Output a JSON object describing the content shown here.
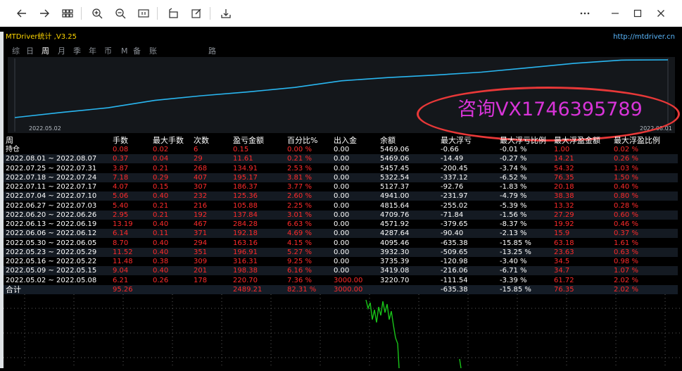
{
  "toolbar": {
    "icons": [
      "back-arrow-icon",
      "forward-arrow-icon",
      "grid-icon",
      "zoom-in-icon",
      "zoom-out-icon",
      "fit-icon",
      "rotate-icon",
      "edit-icon",
      "save-icon",
      "more-icon",
      "minimize-icon",
      "maximize-icon",
      "close-icon"
    ]
  },
  "panel": {
    "title": "MTDriver统计 ,V3.25",
    "url": "http://mtdriver.cn",
    "tabs": [
      "综",
      "日",
      "周",
      "月",
      "季",
      "年",
      "币",
      "M",
      "备",
      "账户",
      "路径"
    ],
    "active_tab": "周"
  },
  "chart": {
    "start_date": "2022.05.02",
    "end_date": "2022.08.01",
    "line_color": "#29b6f0"
  },
  "watermark": {
    "text": "咨询VX1746395789"
  },
  "table": {
    "headers": [
      "周",
      "手数",
      "最大手数",
      "次数",
      "盈亏金额",
      "百分比%",
      "出入金",
      "余额",
      "最大浮亏",
      "最大浮亏比例",
      "最大浮盈金额",
      "最大浮盈比例"
    ],
    "rows": [
      [
        "持仓",
        "0.08",
        "0.02",
        "6",
        "0.15",
        "0.00 %",
        "0.00",
        "5469.06",
        "-0.66",
        "-0.01 %",
        "1.00",
        "0.02 %"
      ],
      [
        "2022.08.01 ~ 2022.08.07",
        "0.37",
        "0.04",
        "29",
        "11.61",
        "0.21 %",
        "0.00",
        "5469.06",
        "-14.49",
        "-0.27 %",
        "14.21",
        "0.26 %"
      ],
      [
        "2022.07.25 ~ 2022.07.31",
        "3.87",
        "0.21",
        "268",
        "134.91",
        "2.53 %",
        "0.00",
        "5457.45",
        "-200.45",
        "-3.74 %",
        "54.32",
        "1.03 %"
      ],
      [
        "2022.07.18 ~ 2022.07.24",
        "7.18",
        "0.29",
        "407",
        "195.17",
        "3.81 %",
        "0.00",
        "5322.54",
        "-337.12",
        "-6.52 %",
        "76.35",
        "1.50 %"
      ],
      [
        "2022.07.11 ~ 2022.07.17",
        "4.07",
        "0.15",
        "307",
        "186.37",
        "3.77 %",
        "0.00",
        "5127.37",
        "-92.76",
        "-1.83 %",
        "20.18",
        "0.40 %"
      ],
      [
        "2022.07.04 ~ 2022.07.10",
        "5.06",
        "0.40",
        "232",
        "125.36",
        "2.60 %",
        "0.00",
        "4941.00",
        "-231.97",
        "-4.79 %",
        "38.38",
        "0.80 %"
      ],
      [
        "2022.06.27 ~ 2022.07.03",
        "5.40",
        "0.21",
        "216",
        "105.88",
        "2.25 %",
        "0.00",
        "4815.64",
        "-255.02",
        "-5.39 %",
        "13.32",
        "0.28 %"
      ],
      [
        "2022.06.20 ~ 2022.06.26",
        "2.95",
        "0.21",
        "192",
        "137.84",
        "3.01 %",
        "0.00",
        "4709.76",
        "-71.84",
        "-1.56 %",
        "27.29",
        "0.60 %"
      ],
      [
        "2022.06.13 ~ 2022.06.19",
        "13.19",
        "0.40",
        "467",
        "284.28",
        "6.63 %",
        "0.00",
        "4571.92",
        "-379.65",
        "-8.37 %",
        "19.92",
        "0.46 %"
      ],
      [
        "2022.06.06 ~ 2022.06.12",
        "6.14",
        "0.11",
        "371",
        "192.18",
        "4.69 %",
        "0.00",
        "4287.64",
        "-90.40",
        "-2.13 %",
        "15.9",
        "0.37 %"
      ],
      [
        "2022.05.30 ~ 2022.06.05",
        "8.70",
        "0.40",
        "294",
        "163.16",
        "4.15 %",
        "0.00",
        "4095.46",
        "-635.38",
        "-15.85 %",
        "63.18",
        "1.61 %"
      ],
      [
        "2022.05.23 ~ 2022.05.29",
        "11.52",
        "0.40",
        "351",
        "196.91",
        "5.27 %",
        "0.00",
        "3932.30",
        "-509.65",
        "-13.25 %",
        "23.63",
        "0.63 %"
      ],
      [
        "2022.05.16 ~ 2022.05.22",
        "11.48",
        "0.38",
        "309",
        "316.31",
        "9.25 %",
        "0.00",
        "3735.39",
        "-120.98",
        "-3.40 %",
        "34.5",
        "0.98 %"
      ],
      [
        "2022.05.09 ~ 2022.05.15",
        "9.04",
        "0.40",
        "201",
        "198.38",
        "6.16 %",
        "0.00",
        "3419.08",
        "-216.06",
        "-6.71 %",
        "34.7",
        "1.07 %"
      ],
      [
        "2022.05.02 ~ 2022.05.08",
        "6.21",
        "0.26",
        "178",
        "220.70",
        "7.36 %",
        "3000.00",
        "3220.70",
        "-111.54",
        "-3.39 %",
        "61.72",
        "2.02 %"
      ]
    ],
    "total": [
      "合计",
      "95.26",
      "",
      "",
      "2489.21",
      "82.31 %",
      "3000.00",
      "",
      "-635.38",
      "-15.85 %",
      "76.35",
      "2.02 %"
    ]
  }
}
